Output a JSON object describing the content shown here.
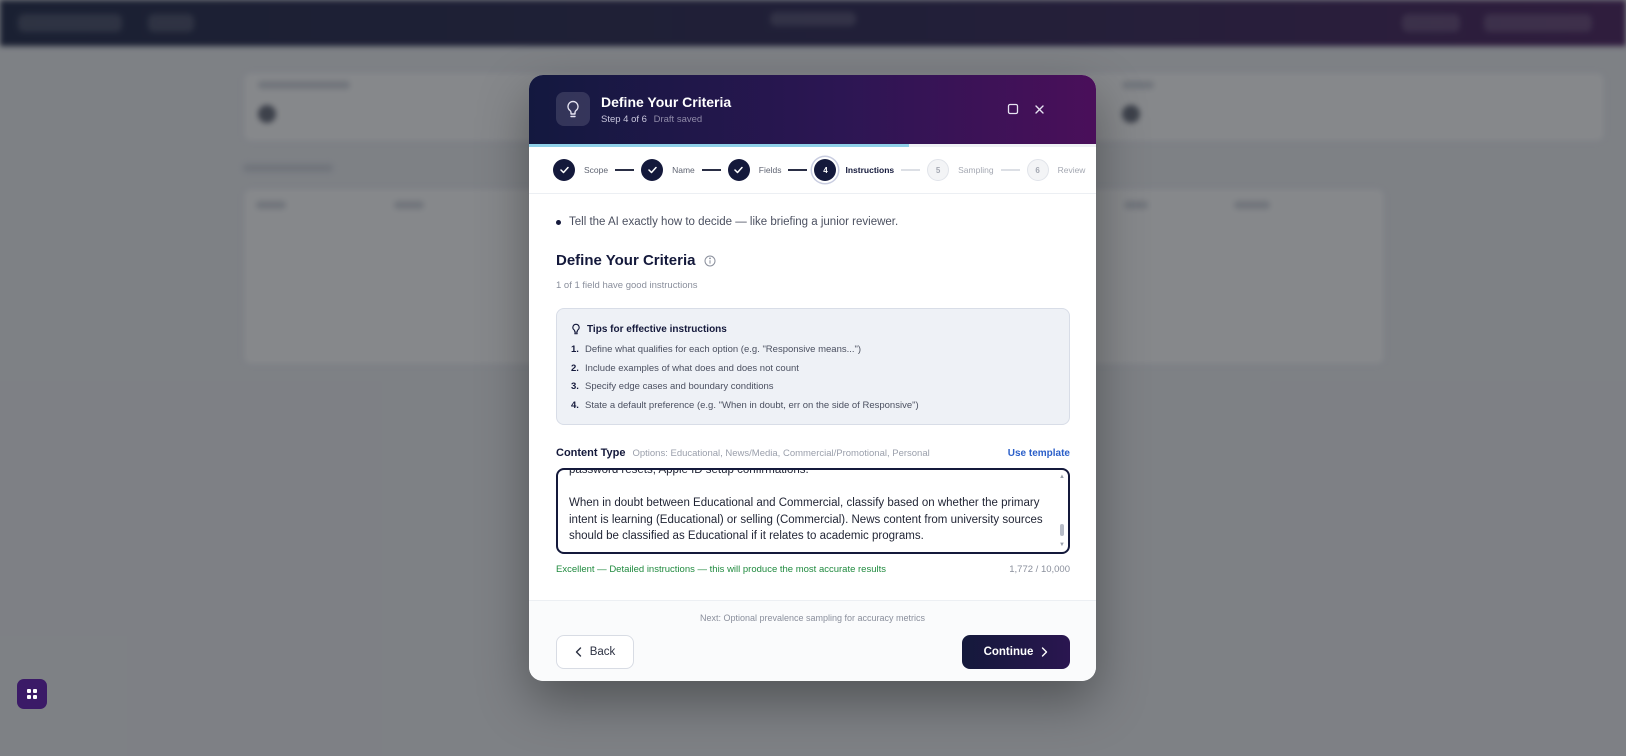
{
  "colors": {
    "header_gradient_start": "#13183f",
    "header_gradient_end": "#4a0f5a",
    "accent_dark": "#14193b",
    "success_text": "#1f8a3e",
    "link": "#2b5fc9"
  },
  "modal": {
    "icon": "lightbulb-icon",
    "title": "Define Your Criteria",
    "step_text": "Step 4 of 6",
    "draft_text": "Draft saved",
    "maximize_icon": "maximize-icon",
    "close_icon": "close-icon",
    "progress_fraction": 0.67
  },
  "stepper": {
    "steps": [
      {
        "label": "Scope",
        "number": "1",
        "state": "done"
      },
      {
        "label": "Name",
        "number": "2",
        "state": "done"
      },
      {
        "label": "Fields",
        "number": "3",
        "state": "done"
      },
      {
        "label": "Instructions",
        "number": "4",
        "state": "active"
      },
      {
        "label": "Sampling",
        "number": "5",
        "state": "todo"
      },
      {
        "label": "Review",
        "number": "6",
        "state": "todo"
      }
    ]
  },
  "body": {
    "tip_line": "Tell the AI exactly how to decide — like briefing a junior reviewer.",
    "section_title": "Define Your Criteria",
    "section_sub": "1 of 1 field have good instructions",
    "tips": {
      "title": "Tips for effective instructions",
      "items": [
        {
          "num": "1.",
          "text": "Define what qualifies for each option (e.g. \"Responsive means...\")"
        },
        {
          "num": "2.",
          "text": "Include examples of what does and does not count"
        },
        {
          "num": "3.",
          "text": "Specify edge cases and boundary conditions"
        },
        {
          "num": "4.",
          "text": "State a default preference (e.g. \"When in doubt, err on the side of Responsive\")"
        }
      ]
    },
    "field": {
      "label": "Content Type",
      "options": "Options: Educational, News/Media, Commercial/Promotional, Personal",
      "template_link": "Use template",
      "value": "password resets, Apple ID setup confirmations.\n\nWhen in doubt between Educational and Commercial, classify based on whether the primary intent is learning (Educational) or selling (Commercial). News content from university sources should be classified as Educational if it relates to academic programs.",
      "quality": "Excellent — Detailed instructions — this will produce the most accurate results",
      "char_count": "1,772 / 10,000"
    }
  },
  "footer": {
    "next_note": "Next: Optional prevalence sampling for accuracy metrics",
    "back_label": "Back",
    "continue_label": "Continue"
  },
  "background": {
    "fab_icon": "grid-icon"
  }
}
